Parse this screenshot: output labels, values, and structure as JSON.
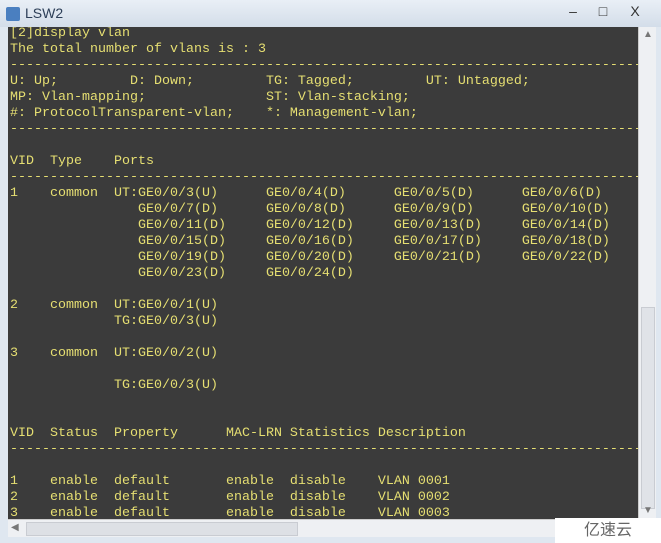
{
  "window": {
    "title": "LSW2",
    "minimize": "‒",
    "maximize": "□",
    "close": "X"
  },
  "terminal": {
    "lines": [
      "[2]display vlan",
      "The total number of vlans is : 3",
      "-------------------------------------------------------------------------------",
      "U: Up;         D: Down;         TG: Tagged;         UT: Untagged;",
      "MP: Vlan-mapping;               ST: Vlan-stacking;",
      "#: ProtocolTransparent-vlan;    *: Management-vlan;",
      "-------------------------------------------------------------------------------",
      "",
      "VID  Type    Ports",
      "-------------------------------------------------------------------------------",
      "1    common  UT:GE0/0/3(U)      GE0/0/4(D)      GE0/0/5(D)      GE0/0/6(D)",
      "                GE0/0/7(D)      GE0/0/8(D)      GE0/0/9(D)      GE0/0/10(D)",
      "                GE0/0/11(D)     GE0/0/12(D)     GE0/0/13(D)     GE0/0/14(D)",
      "                GE0/0/15(D)     GE0/0/16(D)     GE0/0/17(D)     GE0/0/18(D)",
      "                GE0/0/19(D)     GE0/0/20(D)     GE0/0/21(D)     GE0/0/22(D)",
      "                GE0/0/23(D)     GE0/0/24(D)",
      "",
      "2    common  UT:GE0/0/1(U)",
      "             TG:GE0/0/3(U)",
      "",
      "3    common  UT:GE0/0/2(U)",
      "",
      "             TG:GE0/0/3(U)",
      "",
      "",
      "VID  Status  Property      MAC-LRN Statistics Description",
      "-------------------------------------------------------------------------------",
      "",
      "1    enable  default       enable  disable    VLAN 0001",
      "2    enable  default       enable  disable    VLAN 0002",
      "3    enable  default       enable  disable    VLAN 0003"
    ]
  },
  "colors": {
    "terminal_bg": "#3b3b3b",
    "terminal_text": "#e6df72"
  },
  "watermark": "亿速云"
}
